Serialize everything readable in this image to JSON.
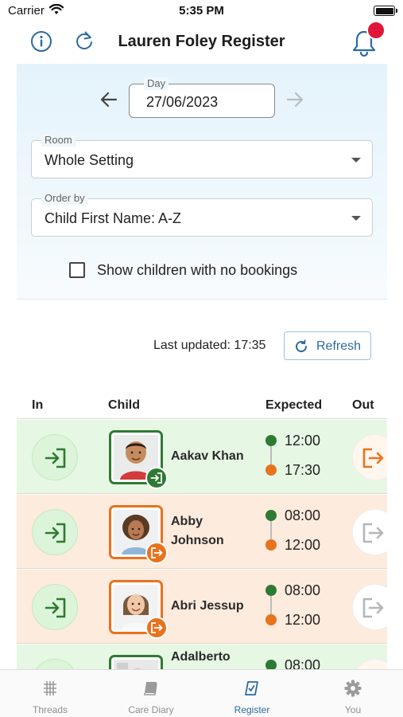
{
  "status_bar": {
    "carrier": "Carrier",
    "time": "5:35 PM"
  },
  "header": {
    "title": "Lauren Foley Register"
  },
  "filters": {
    "day": {
      "label": "Day",
      "value": "27/06/2023"
    },
    "room": {
      "label": "Room",
      "value": "Whole Setting"
    },
    "order_by": {
      "label": "Order by",
      "value": "Child First Name: A-Z"
    },
    "no_bookings": {
      "label": "Show children with no bookings",
      "checked": false
    }
  },
  "update": {
    "text": "Last updated: 17:35",
    "refresh_label": "Refresh"
  },
  "table": {
    "columns": {
      "in": "In",
      "child": "Child",
      "expected": "Expected",
      "out": "Out"
    },
    "rows": [
      {
        "name": "Aakav Khan",
        "status": "checked-in",
        "start": "12:00",
        "end": "17:30"
      },
      {
        "name": "Abby Johnson",
        "name_line1": "Abby",
        "name_line2": "Johnson",
        "status": "checked-out",
        "start": "08:00",
        "end": "12:00"
      },
      {
        "name": "Abri Jessup",
        "status": "checked-out",
        "start": "08:00",
        "end": "12:00"
      },
      {
        "name": "Adalberto",
        "status": "checked-in",
        "start": "08:00",
        "end": ""
      }
    ]
  },
  "tabs": [
    {
      "label": "Threads",
      "icon": "threads-icon",
      "active": false
    },
    {
      "label": "Care Diary",
      "icon": "book-icon",
      "active": false
    },
    {
      "label": "Register",
      "icon": "register-icon",
      "active": true
    },
    {
      "label": "You",
      "icon": "gear-icon",
      "active": false
    }
  ],
  "colors": {
    "accent": "#2b6aa3",
    "checked_in_row": "#e6f7e4",
    "checked_out_row": "#fdebdd",
    "green": "#2f7a33",
    "orange": "#e7731e",
    "notification": "#e0163a"
  }
}
